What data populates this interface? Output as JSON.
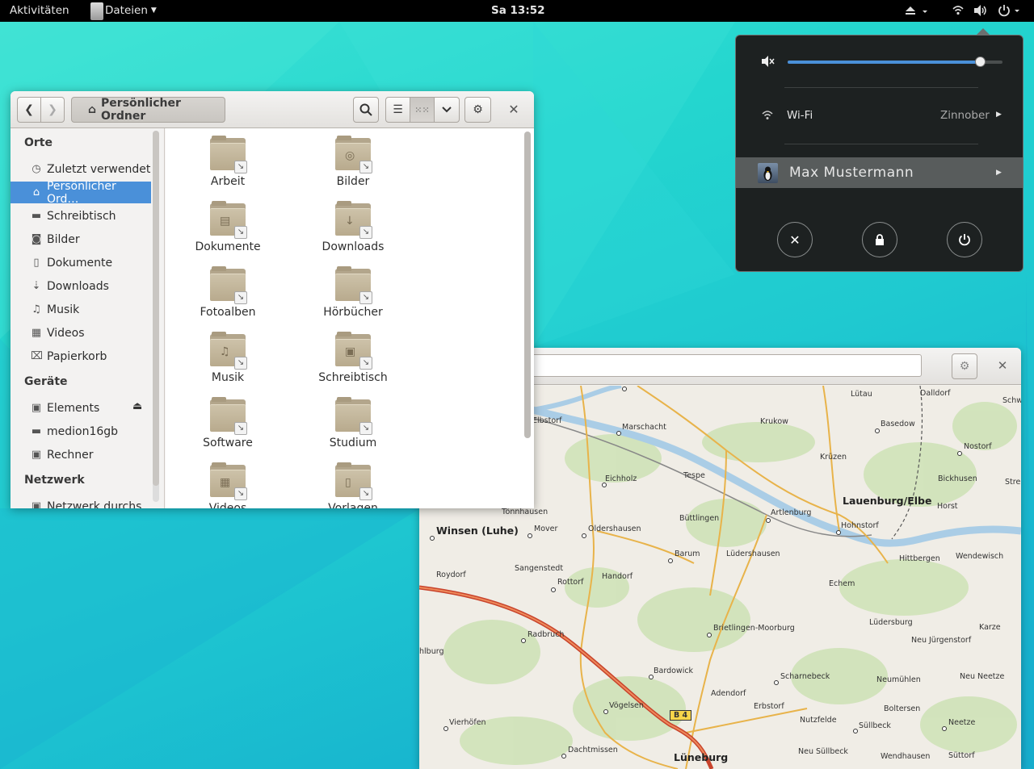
{
  "topbar": {
    "activities": "Aktivitäten",
    "app_menu": "Dateien",
    "clock": "Sa 13:52"
  },
  "files": {
    "path_label": "Persönlicher Ordner",
    "sidebar": {
      "places_heading": "Orte",
      "places": [
        {
          "label": "Zuletzt verwendet",
          "icon": "clock-icon"
        },
        {
          "label": "Persönlicher Ord…",
          "icon": "home-icon",
          "selected": true
        },
        {
          "label": "Schreibtisch",
          "icon": "desktop-icon"
        },
        {
          "label": "Bilder",
          "icon": "camera-icon"
        },
        {
          "label": "Dokumente",
          "icon": "document-icon"
        },
        {
          "label": "Downloads",
          "icon": "download-icon"
        },
        {
          "label": "Musik",
          "icon": "music-icon"
        },
        {
          "label": "Videos",
          "icon": "film-icon"
        },
        {
          "label": "Papierkorb",
          "icon": "trash-icon"
        }
      ],
      "devices_heading": "Geräte",
      "devices": [
        {
          "label": "Elements",
          "icon": "drive-icon"
        },
        {
          "label": "medion16gb",
          "icon": "usb-drive-icon"
        },
        {
          "label": "Rechner",
          "icon": "computer-icon"
        }
      ],
      "network_heading": "Netzwerk",
      "network": [
        {
          "label": "Netzwerk durchs…",
          "icon": "network-icon"
        }
      ]
    },
    "folders": [
      {
        "label": "Arbeit",
        "glyph": ""
      },
      {
        "label": "Bilder",
        "glyph": "◎"
      },
      {
        "label": "Dokumente",
        "glyph": "▤"
      },
      {
        "label": "Downloads",
        "glyph": "↓"
      },
      {
        "label": "Fotoalben",
        "glyph": ""
      },
      {
        "label": "Hörbücher",
        "glyph": ""
      },
      {
        "label": "Musik",
        "glyph": "♫"
      },
      {
        "label": "Schreibtisch",
        "glyph": "▣"
      },
      {
        "label": "Software",
        "glyph": ""
      },
      {
        "label": "Studium",
        "glyph": ""
      },
      {
        "label": "Videos",
        "glyph": "▦"
      },
      {
        "label": "Vorlagen",
        "glyph": "▯"
      }
    ]
  },
  "sysmenu": {
    "volume": 0.9,
    "wifi_label": "Wi-Fi",
    "wifi_network": "Zinnober",
    "user_name": "Max Mustermann"
  },
  "maps": {
    "places": [
      {
        "name": "Lütau"
      },
      {
        "name": "Dalldorf"
      },
      {
        "name": "Elbstorf"
      },
      {
        "name": "Krukow"
      },
      {
        "name": "Marschacht"
      },
      {
        "name": "Basedow"
      },
      {
        "name": "Nostorf"
      },
      {
        "name": "Krüzen"
      },
      {
        "name": "Eichholz"
      },
      {
        "name": "Tespe"
      },
      {
        "name": "Bickhusen"
      },
      {
        "name": "Lauenburg/Elbe"
      },
      {
        "name": "Tönnhausen"
      },
      {
        "name": "Büttlingen"
      },
      {
        "name": "Artlenburg"
      },
      {
        "name": "Horst"
      },
      {
        "name": "Winsen (Luhe)"
      },
      {
        "name": "Mover"
      },
      {
        "name": "Oldershausen"
      },
      {
        "name": "Hohnstorf"
      },
      {
        "name": "Barum"
      },
      {
        "name": "Lüdershausen"
      },
      {
        "name": "Hittbergen"
      },
      {
        "name": "Wendewisch"
      },
      {
        "name": "Sangenstedt"
      },
      {
        "name": "Roydorf"
      },
      {
        "name": "Handorf"
      },
      {
        "name": "Rottorf"
      },
      {
        "name": "Echem"
      },
      {
        "name": "Radbruch"
      },
      {
        "name": "Brietlingen-Moorburg"
      },
      {
        "name": "Lüdersburg"
      },
      {
        "name": "Karze"
      },
      {
        "name": "Neu Jürgenstorf"
      },
      {
        "name": "Bardowick"
      },
      {
        "name": "Scharnebeck"
      },
      {
        "name": "Neumühlen"
      },
      {
        "name": "Neu Neetze"
      },
      {
        "name": "Adendorf"
      },
      {
        "name": "Vögelsen"
      },
      {
        "name": "Erbstorf"
      },
      {
        "name": "Boltersen"
      },
      {
        "name": "Vierhöfen"
      },
      {
        "name": "Nutzfelde"
      },
      {
        "name": "Neetze"
      },
      {
        "name": "Süllbeck"
      },
      {
        "name": "Dachtmissen"
      },
      {
        "name": "Lüneburg"
      },
      {
        "name": "Neu Süllbeck"
      },
      {
        "name": "Wendhausen"
      },
      {
        "name": "Süttorf"
      },
      {
        "name": "B 4"
      },
      {
        "name": "Schw"
      },
      {
        "name": "Stre"
      },
      {
        "name": "hlburg"
      }
    ]
  }
}
